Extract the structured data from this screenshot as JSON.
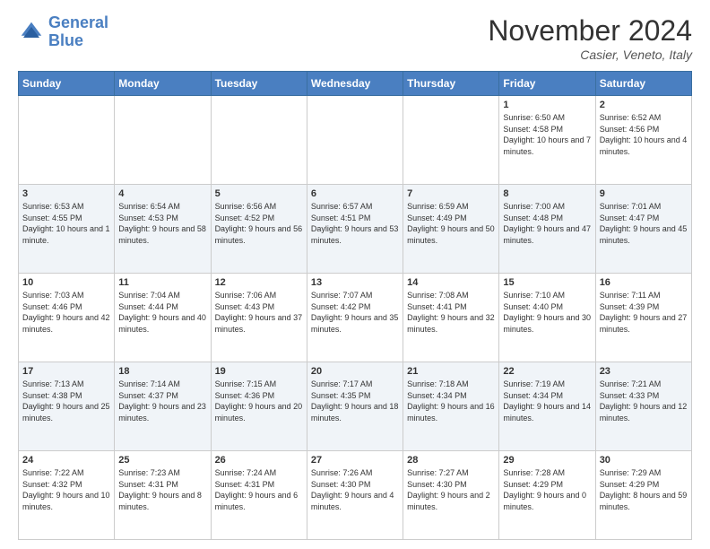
{
  "header": {
    "logo_text_general": "General",
    "logo_text_blue": "Blue",
    "month_title": "November 2024",
    "location": "Casier, Veneto, Italy"
  },
  "calendar": {
    "days_of_week": [
      "Sunday",
      "Monday",
      "Tuesday",
      "Wednesday",
      "Thursday",
      "Friday",
      "Saturday"
    ],
    "weeks": [
      [
        {
          "day": "",
          "info": ""
        },
        {
          "day": "",
          "info": ""
        },
        {
          "day": "",
          "info": ""
        },
        {
          "day": "",
          "info": ""
        },
        {
          "day": "",
          "info": ""
        },
        {
          "day": "1",
          "info": "Sunrise: 6:50 AM\nSunset: 4:58 PM\nDaylight: 10 hours\nand 7 minutes."
        },
        {
          "day": "2",
          "info": "Sunrise: 6:52 AM\nSunset: 4:56 PM\nDaylight: 10 hours\nand 4 minutes."
        }
      ],
      [
        {
          "day": "3",
          "info": "Sunrise: 6:53 AM\nSunset: 4:55 PM\nDaylight: 10 hours\nand 1 minute."
        },
        {
          "day": "4",
          "info": "Sunrise: 6:54 AM\nSunset: 4:53 PM\nDaylight: 9 hours\nand 58 minutes."
        },
        {
          "day": "5",
          "info": "Sunrise: 6:56 AM\nSunset: 4:52 PM\nDaylight: 9 hours\nand 56 minutes."
        },
        {
          "day": "6",
          "info": "Sunrise: 6:57 AM\nSunset: 4:51 PM\nDaylight: 9 hours\nand 53 minutes."
        },
        {
          "day": "7",
          "info": "Sunrise: 6:59 AM\nSunset: 4:49 PM\nDaylight: 9 hours\nand 50 minutes."
        },
        {
          "day": "8",
          "info": "Sunrise: 7:00 AM\nSunset: 4:48 PM\nDaylight: 9 hours\nand 47 minutes."
        },
        {
          "day": "9",
          "info": "Sunrise: 7:01 AM\nSunset: 4:47 PM\nDaylight: 9 hours\nand 45 minutes."
        }
      ],
      [
        {
          "day": "10",
          "info": "Sunrise: 7:03 AM\nSunset: 4:46 PM\nDaylight: 9 hours\nand 42 minutes."
        },
        {
          "day": "11",
          "info": "Sunrise: 7:04 AM\nSunset: 4:44 PM\nDaylight: 9 hours\nand 40 minutes."
        },
        {
          "day": "12",
          "info": "Sunrise: 7:06 AM\nSunset: 4:43 PM\nDaylight: 9 hours\nand 37 minutes."
        },
        {
          "day": "13",
          "info": "Sunrise: 7:07 AM\nSunset: 4:42 PM\nDaylight: 9 hours\nand 35 minutes."
        },
        {
          "day": "14",
          "info": "Sunrise: 7:08 AM\nSunset: 4:41 PM\nDaylight: 9 hours\nand 32 minutes."
        },
        {
          "day": "15",
          "info": "Sunrise: 7:10 AM\nSunset: 4:40 PM\nDaylight: 9 hours\nand 30 minutes."
        },
        {
          "day": "16",
          "info": "Sunrise: 7:11 AM\nSunset: 4:39 PM\nDaylight: 9 hours\nand 27 minutes."
        }
      ],
      [
        {
          "day": "17",
          "info": "Sunrise: 7:13 AM\nSunset: 4:38 PM\nDaylight: 9 hours\nand 25 minutes."
        },
        {
          "day": "18",
          "info": "Sunrise: 7:14 AM\nSunset: 4:37 PM\nDaylight: 9 hours\nand 23 minutes."
        },
        {
          "day": "19",
          "info": "Sunrise: 7:15 AM\nSunset: 4:36 PM\nDaylight: 9 hours\nand 20 minutes."
        },
        {
          "day": "20",
          "info": "Sunrise: 7:17 AM\nSunset: 4:35 PM\nDaylight: 9 hours\nand 18 minutes."
        },
        {
          "day": "21",
          "info": "Sunrise: 7:18 AM\nSunset: 4:34 PM\nDaylight: 9 hours\nand 16 minutes."
        },
        {
          "day": "22",
          "info": "Sunrise: 7:19 AM\nSunset: 4:34 PM\nDaylight: 9 hours\nand 14 minutes."
        },
        {
          "day": "23",
          "info": "Sunrise: 7:21 AM\nSunset: 4:33 PM\nDaylight: 9 hours\nand 12 minutes."
        }
      ],
      [
        {
          "day": "24",
          "info": "Sunrise: 7:22 AM\nSunset: 4:32 PM\nDaylight: 9 hours\nand 10 minutes."
        },
        {
          "day": "25",
          "info": "Sunrise: 7:23 AM\nSunset: 4:31 PM\nDaylight: 9 hours\nand 8 minutes."
        },
        {
          "day": "26",
          "info": "Sunrise: 7:24 AM\nSunset: 4:31 PM\nDaylight: 9 hours\nand 6 minutes."
        },
        {
          "day": "27",
          "info": "Sunrise: 7:26 AM\nSunset: 4:30 PM\nDaylight: 9 hours\nand 4 minutes."
        },
        {
          "day": "28",
          "info": "Sunrise: 7:27 AM\nSunset: 4:30 PM\nDaylight: 9 hours\nand 2 minutes."
        },
        {
          "day": "29",
          "info": "Sunrise: 7:28 AM\nSunset: 4:29 PM\nDaylight: 9 hours\nand 0 minutes."
        },
        {
          "day": "30",
          "info": "Sunrise: 7:29 AM\nSunset: 4:29 PM\nDaylight: 8 hours\nand 59 minutes."
        }
      ]
    ]
  }
}
